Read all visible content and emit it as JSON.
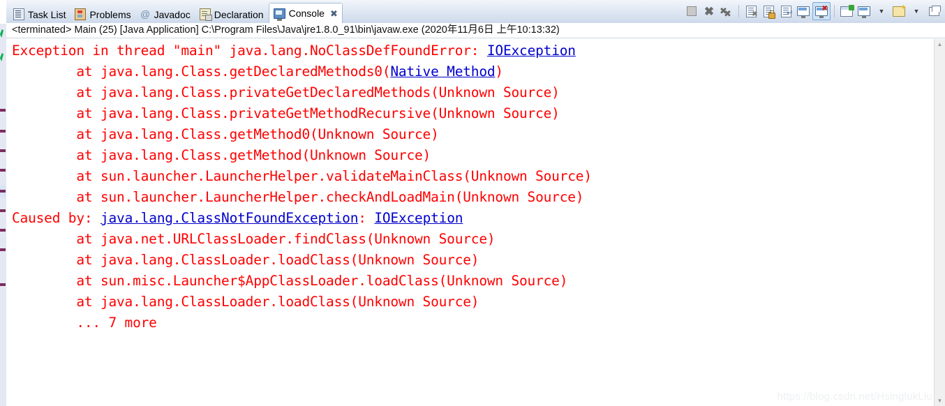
{
  "window": {
    "app": "Eclipse IDE",
    "watermark": "https://blog.csdn.net/HsinglukLiu"
  },
  "tabs": [
    {
      "label": "Task List",
      "icon": "task-list-icon",
      "active": false,
      "closable": false
    },
    {
      "label": "Problems",
      "icon": "problems-icon",
      "active": false,
      "closable": false
    },
    {
      "label": "Javadoc",
      "icon": "javadoc-icon",
      "active": false,
      "closable": false
    },
    {
      "label": "Declaration",
      "icon": "declaration-icon",
      "active": false,
      "closable": false
    },
    {
      "label": "Console",
      "icon": "console-icon",
      "active": true,
      "closable": true,
      "close_glyph": "✖"
    }
  ],
  "toolbar": {
    "buttons": [
      {
        "name": "terminate-button",
        "title": "Terminate"
      },
      {
        "name": "remove-launch-button",
        "title": "Remove Launch"
      },
      {
        "name": "remove-all-launches-button",
        "title": "Remove All Terminated Launches"
      },
      {
        "name": "clear-console-button",
        "title": "Clear Console"
      },
      {
        "name": "scroll-lock-button",
        "title": "Scroll Lock"
      },
      {
        "name": "word-wrap-button",
        "title": "Word Wrap"
      },
      {
        "name": "show-console-on-output-button",
        "title": "Show Console When Standard Out Changes"
      },
      {
        "name": "show-console-on-error-button",
        "title": "Show Console When Standard Error Changes"
      },
      {
        "name": "pin-console-button",
        "title": "Pin Console"
      },
      {
        "name": "display-selected-console-button",
        "title": "Display Selected Console"
      },
      {
        "name": "open-console-button",
        "title": "Open Console"
      },
      {
        "name": "view-menu-button",
        "title": "View Menu"
      },
      {
        "name": "minimize-restore-button",
        "title": "Restore"
      }
    ],
    "caret_glyph": "▼"
  },
  "status": {
    "text": "<terminated> Main (25) [Java Application] C:\\Program Files\\Java\\jre1.8.0_91\\bin\\javaw.exe (2020年11月6日 上午10:13:32)"
  },
  "console": {
    "lines": [
      {
        "id": "line-1",
        "segs": [
          {
            "t": "Exception in thread \"main\" java.lang.NoClassDefFoundError: ",
            "link": false
          },
          {
            "t": "IOException",
            "link": true
          }
        ]
      },
      {
        "id": "line-2",
        "segs": [
          {
            "t": "        at java.lang.Class.getDeclaredMethods0(",
            "link": false
          },
          {
            "t": "Native Method",
            "link": true
          },
          {
            "t": ")",
            "link": false
          }
        ]
      },
      {
        "id": "line-3",
        "segs": [
          {
            "t": "        at java.lang.Class.privateGetDeclaredMethods(Unknown Source)",
            "link": false
          }
        ]
      },
      {
        "id": "line-4",
        "segs": [
          {
            "t": "        at java.lang.Class.privateGetMethodRecursive(Unknown Source)",
            "link": false
          }
        ]
      },
      {
        "id": "line-5",
        "segs": [
          {
            "t": "        at java.lang.Class.getMethod0(Unknown Source)",
            "link": false
          }
        ]
      },
      {
        "id": "line-6",
        "segs": [
          {
            "t": "        at java.lang.Class.getMethod(Unknown Source)",
            "link": false
          }
        ]
      },
      {
        "id": "line-7",
        "segs": [
          {
            "t": "        at sun.launcher.LauncherHelper.validateMainClass(Unknown Source)",
            "link": false
          }
        ]
      },
      {
        "id": "line-8",
        "segs": [
          {
            "t": "        at sun.launcher.LauncherHelper.checkAndLoadMain(Unknown Source)",
            "link": false
          }
        ]
      },
      {
        "id": "line-9",
        "segs": [
          {
            "t": "Caused by: ",
            "link": false
          },
          {
            "t": "java.lang.ClassNotFoundException",
            "link": true
          },
          {
            "t": ": ",
            "link": false
          },
          {
            "t": "IOException",
            "link": true
          }
        ]
      },
      {
        "id": "line-10",
        "segs": [
          {
            "t": "        at java.net.URLClassLoader.findClass(Unknown Source)",
            "link": false
          }
        ]
      },
      {
        "id": "line-11",
        "segs": [
          {
            "t": "        at java.lang.ClassLoader.loadClass(Unknown Source)",
            "link": false
          }
        ]
      },
      {
        "id": "line-12",
        "segs": [
          {
            "t": "        at sun.misc.Launcher$AppClassLoader.loadClass(Unknown Source)",
            "link": false
          }
        ]
      },
      {
        "id": "line-13",
        "segs": [
          {
            "t": "        at java.lang.ClassLoader.loadClass(Unknown Source)",
            "link": false
          }
        ]
      },
      {
        "id": "line-14",
        "segs": [
          {
            "t": "        ... 7 more",
            "link": false
          }
        ]
      }
    ]
  },
  "scrollbar": {
    "up_glyph": "▲",
    "down_glyph": "▼"
  },
  "colors": {
    "error_text": "#ff0000",
    "link_text": "#0000cc",
    "tab_active_bg": "#ffffff",
    "tabbar_bg": "#dde6f2",
    "selected_toolbar_bg": "#cfe3f7"
  }
}
